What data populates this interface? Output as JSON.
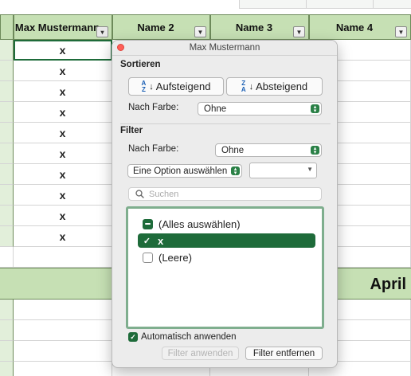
{
  "sheet": {
    "headers": [
      {
        "label": "Max Mustermann",
        "filter_active": true
      },
      {
        "label": "Name 2",
        "filter_active": false
      },
      {
        "label": "Name 3",
        "filter_active": false
      },
      {
        "label": "Name 4",
        "filter_active": false
      }
    ],
    "rows": [
      "x",
      "x",
      "x",
      "x",
      "x",
      "x",
      "x",
      "x",
      "x",
      "x"
    ],
    "month_label": "April",
    "colors": {
      "header_green": "#c6e0b4",
      "col_green": "#e2efda",
      "accent": "#1e6b3a"
    }
  },
  "popover": {
    "title": "Max Mustermann",
    "sort": {
      "heading": "Sortieren",
      "ascending_label": "Aufsteigend",
      "ascending_icon_top": "A",
      "ascending_icon_bottom": "Z",
      "descending_label": "Absteigend",
      "descending_icon_top": "Z",
      "descending_icon_bottom": "A",
      "by_color_label": "Nach Farbe:",
      "by_color_value": "Ohne"
    },
    "filter": {
      "heading": "Filter",
      "by_color_label": "Nach Farbe:",
      "by_color_value": "Ohne",
      "option_select_value": "Eine Option auswählen",
      "option_value_field": "",
      "search_placeholder": "Suchen",
      "items": [
        {
          "label": "(Alles auswählen)",
          "state": "mixed"
        },
        {
          "label": "x",
          "state": "checked"
        },
        {
          "label": "(Leere)",
          "state": "unchecked"
        }
      ]
    },
    "auto_apply_label": "Automatisch anwenden",
    "apply_label": "Filter anwenden",
    "clear_label": "Filter entfernen"
  }
}
